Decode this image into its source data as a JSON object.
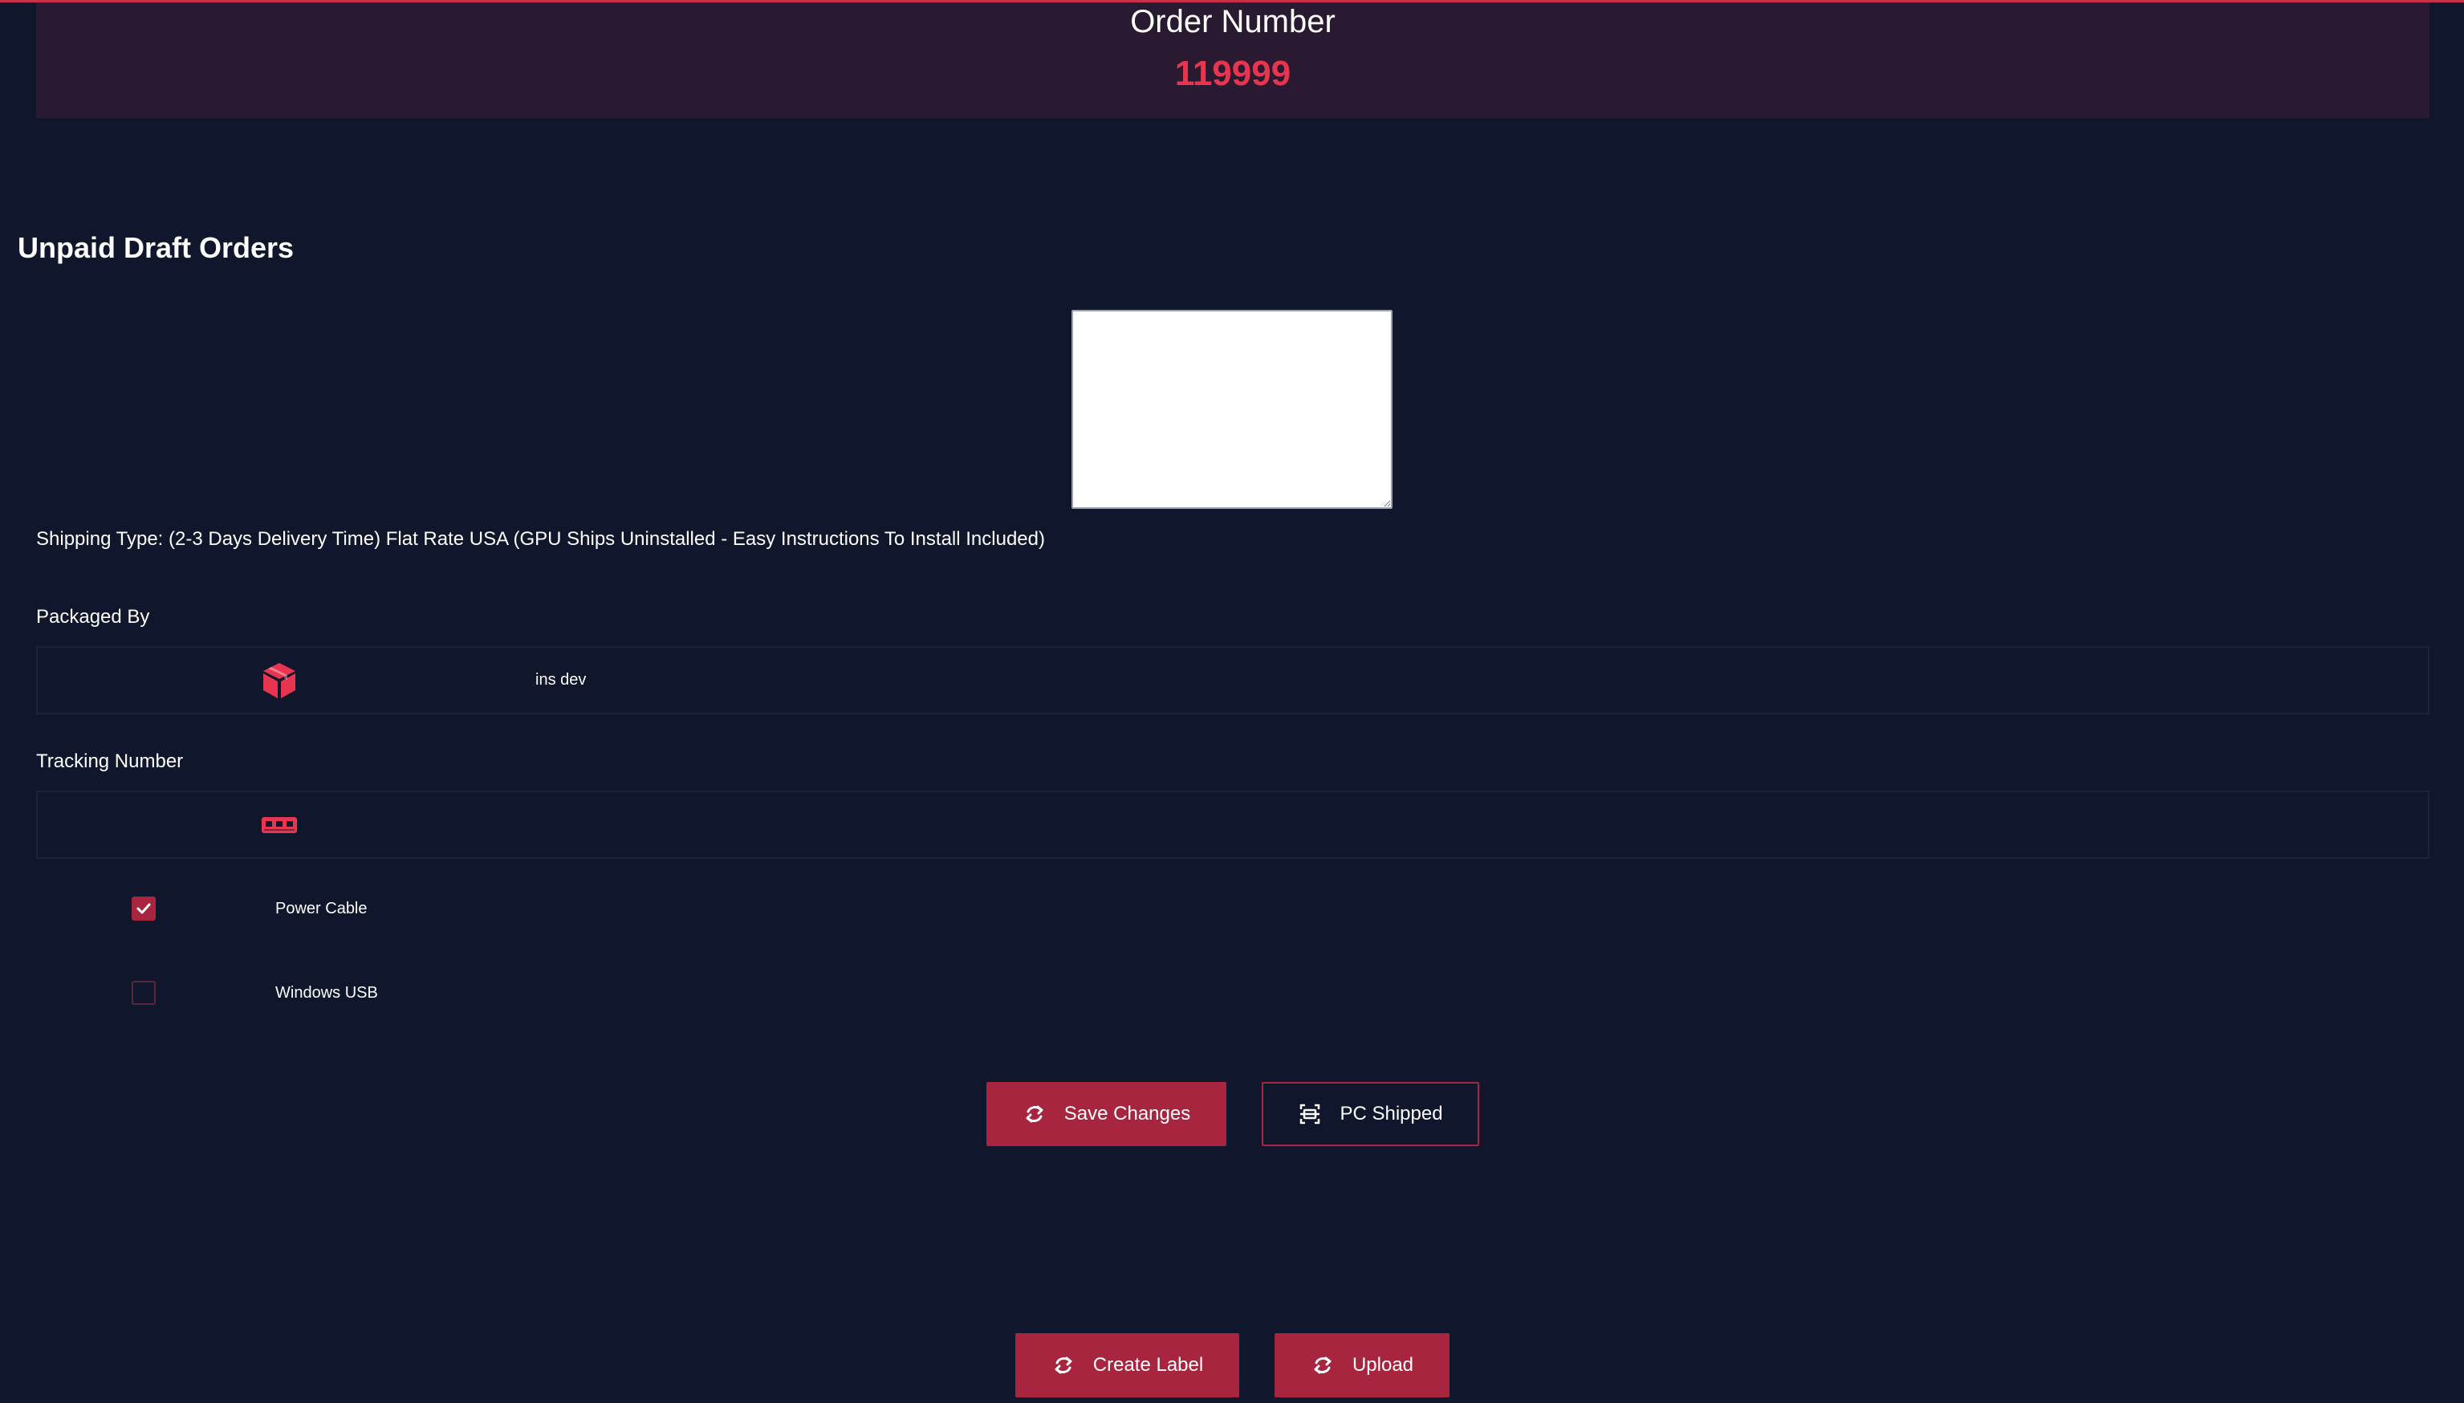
{
  "order": {
    "title": "Order Number",
    "number": "119999"
  },
  "section": {
    "title": "Unpaid Draft Orders"
  },
  "notes": {
    "value": "",
    "placeholder": ""
  },
  "shipping": {
    "text": "Shipping Type: (2-3 Days Delivery Time) Flat Rate USA (GPU Ships Uninstalled - Easy Instructions To Install Included)"
  },
  "packaged_by": {
    "label": "Packaged By",
    "icon": "box-icon",
    "value": "ins dev"
  },
  "tracking": {
    "label": "Tracking Number",
    "icon": "barcode-icon",
    "value": "",
    "placeholder": ""
  },
  "checklist": [
    {
      "label": "Power Cable",
      "checked": true
    },
    {
      "label": "Windows USB",
      "checked": false
    }
  ],
  "buttons": {
    "save_changes": "Save Changes",
    "pc_shipped": "PC Shipped",
    "create_label": "Create Label",
    "upload": "Upload"
  },
  "colors": {
    "background": "#10162b",
    "banner": "#2a1a31",
    "accent": "#e8354f",
    "button": "#a8253f"
  }
}
